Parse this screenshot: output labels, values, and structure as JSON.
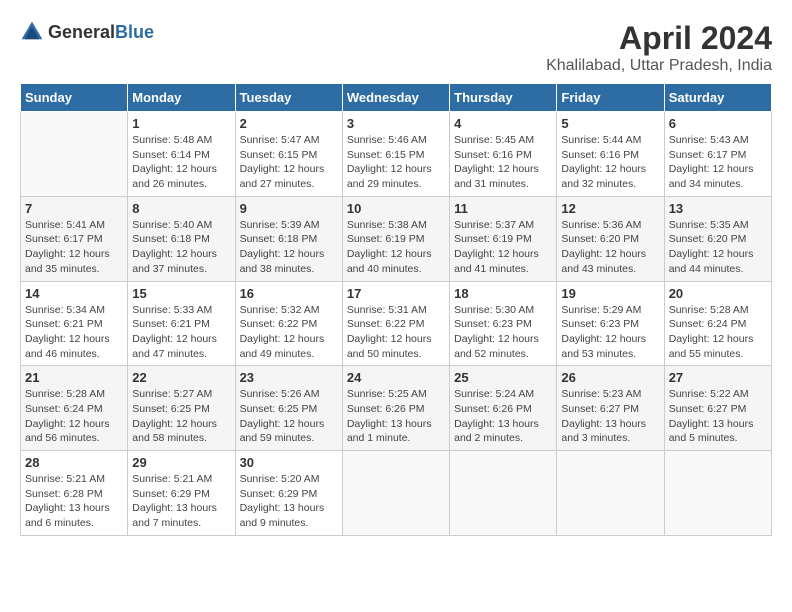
{
  "header": {
    "logo": {
      "text_general": "General",
      "text_blue": "Blue"
    },
    "title": "April 2024",
    "subtitle": "Khalilabad, Uttar Pradesh, India"
  },
  "days_of_week": [
    "Sunday",
    "Monday",
    "Tuesday",
    "Wednesday",
    "Thursday",
    "Friday",
    "Saturday"
  ],
  "weeks": [
    [
      {
        "day": "",
        "info": ""
      },
      {
        "day": "1",
        "info": "Sunrise: 5:48 AM\nSunset: 6:14 PM\nDaylight: 12 hours\nand 26 minutes."
      },
      {
        "day": "2",
        "info": "Sunrise: 5:47 AM\nSunset: 6:15 PM\nDaylight: 12 hours\nand 27 minutes."
      },
      {
        "day": "3",
        "info": "Sunrise: 5:46 AM\nSunset: 6:15 PM\nDaylight: 12 hours\nand 29 minutes."
      },
      {
        "day": "4",
        "info": "Sunrise: 5:45 AM\nSunset: 6:16 PM\nDaylight: 12 hours\nand 31 minutes."
      },
      {
        "day": "5",
        "info": "Sunrise: 5:44 AM\nSunset: 6:16 PM\nDaylight: 12 hours\nand 32 minutes."
      },
      {
        "day": "6",
        "info": "Sunrise: 5:43 AM\nSunset: 6:17 PM\nDaylight: 12 hours\nand 34 minutes."
      }
    ],
    [
      {
        "day": "7",
        "info": "Sunrise: 5:41 AM\nSunset: 6:17 PM\nDaylight: 12 hours\nand 35 minutes."
      },
      {
        "day": "8",
        "info": "Sunrise: 5:40 AM\nSunset: 6:18 PM\nDaylight: 12 hours\nand 37 minutes."
      },
      {
        "day": "9",
        "info": "Sunrise: 5:39 AM\nSunset: 6:18 PM\nDaylight: 12 hours\nand 38 minutes."
      },
      {
        "day": "10",
        "info": "Sunrise: 5:38 AM\nSunset: 6:19 PM\nDaylight: 12 hours\nand 40 minutes."
      },
      {
        "day": "11",
        "info": "Sunrise: 5:37 AM\nSunset: 6:19 PM\nDaylight: 12 hours\nand 41 minutes."
      },
      {
        "day": "12",
        "info": "Sunrise: 5:36 AM\nSunset: 6:20 PM\nDaylight: 12 hours\nand 43 minutes."
      },
      {
        "day": "13",
        "info": "Sunrise: 5:35 AM\nSunset: 6:20 PM\nDaylight: 12 hours\nand 44 minutes."
      }
    ],
    [
      {
        "day": "14",
        "info": "Sunrise: 5:34 AM\nSunset: 6:21 PM\nDaylight: 12 hours\nand 46 minutes."
      },
      {
        "day": "15",
        "info": "Sunrise: 5:33 AM\nSunset: 6:21 PM\nDaylight: 12 hours\nand 47 minutes."
      },
      {
        "day": "16",
        "info": "Sunrise: 5:32 AM\nSunset: 6:22 PM\nDaylight: 12 hours\nand 49 minutes."
      },
      {
        "day": "17",
        "info": "Sunrise: 5:31 AM\nSunset: 6:22 PM\nDaylight: 12 hours\nand 50 minutes."
      },
      {
        "day": "18",
        "info": "Sunrise: 5:30 AM\nSunset: 6:23 PM\nDaylight: 12 hours\nand 52 minutes."
      },
      {
        "day": "19",
        "info": "Sunrise: 5:29 AM\nSunset: 6:23 PM\nDaylight: 12 hours\nand 53 minutes."
      },
      {
        "day": "20",
        "info": "Sunrise: 5:28 AM\nSunset: 6:24 PM\nDaylight: 12 hours\nand 55 minutes."
      }
    ],
    [
      {
        "day": "21",
        "info": "Sunrise: 5:28 AM\nSunset: 6:24 PM\nDaylight: 12 hours\nand 56 minutes."
      },
      {
        "day": "22",
        "info": "Sunrise: 5:27 AM\nSunset: 6:25 PM\nDaylight: 12 hours\nand 58 minutes."
      },
      {
        "day": "23",
        "info": "Sunrise: 5:26 AM\nSunset: 6:25 PM\nDaylight: 12 hours\nand 59 minutes."
      },
      {
        "day": "24",
        "info": "Sunrise: 5:25 AM\nSunset: 6:26 PM\nDaylight: 13 hours\nand 1 minute."
      },
      {
        "day": "25",
        "info": "Sunrise: 5:24 AM\nSunset: 6:26 PM\nDaylight: 13 hours\nand 2 minutes."
      },
      {
        "day": "26",
        "info": "Sunrise: 5:23 AM\nSunset: 6:27 PM\nDaylight: 13 hours\nand 3 minutes."
      },
      {
        "day": "27",
        "info": "Sunrise: 5:22 AM\nSunset: 6:27 PM\nDaylight: 13 hours\nand 5 minutes."
      }
    ],
    [
      {
        "day": "28",
        "info": "Sunrise: 5:21 AM\nSunset: 6:28 PM\nDaylight: 13 hours\nand 6 minutes."
      },
      {
        "day": "29",
        "info": "Sunrise: 5:21 AM\nSunset: 6:29 PM\nDaylight: 13 hours\nand 7 minutes."
      },
      {
        "day": "30",
        "info": "Sunrise: 5:20 AM\nSunset: 6:29 PM\nDaylight: 13 hours\nand 9 minutes."
      },
      {
        "day": "",
        "info": ""
      },
      {
        "day": "",
        "info": ""
      },
      {
        "day": "",
        "info": ""
      },
      {
        "day": "",
        "info": ""
      }
    ]
  ]
}
